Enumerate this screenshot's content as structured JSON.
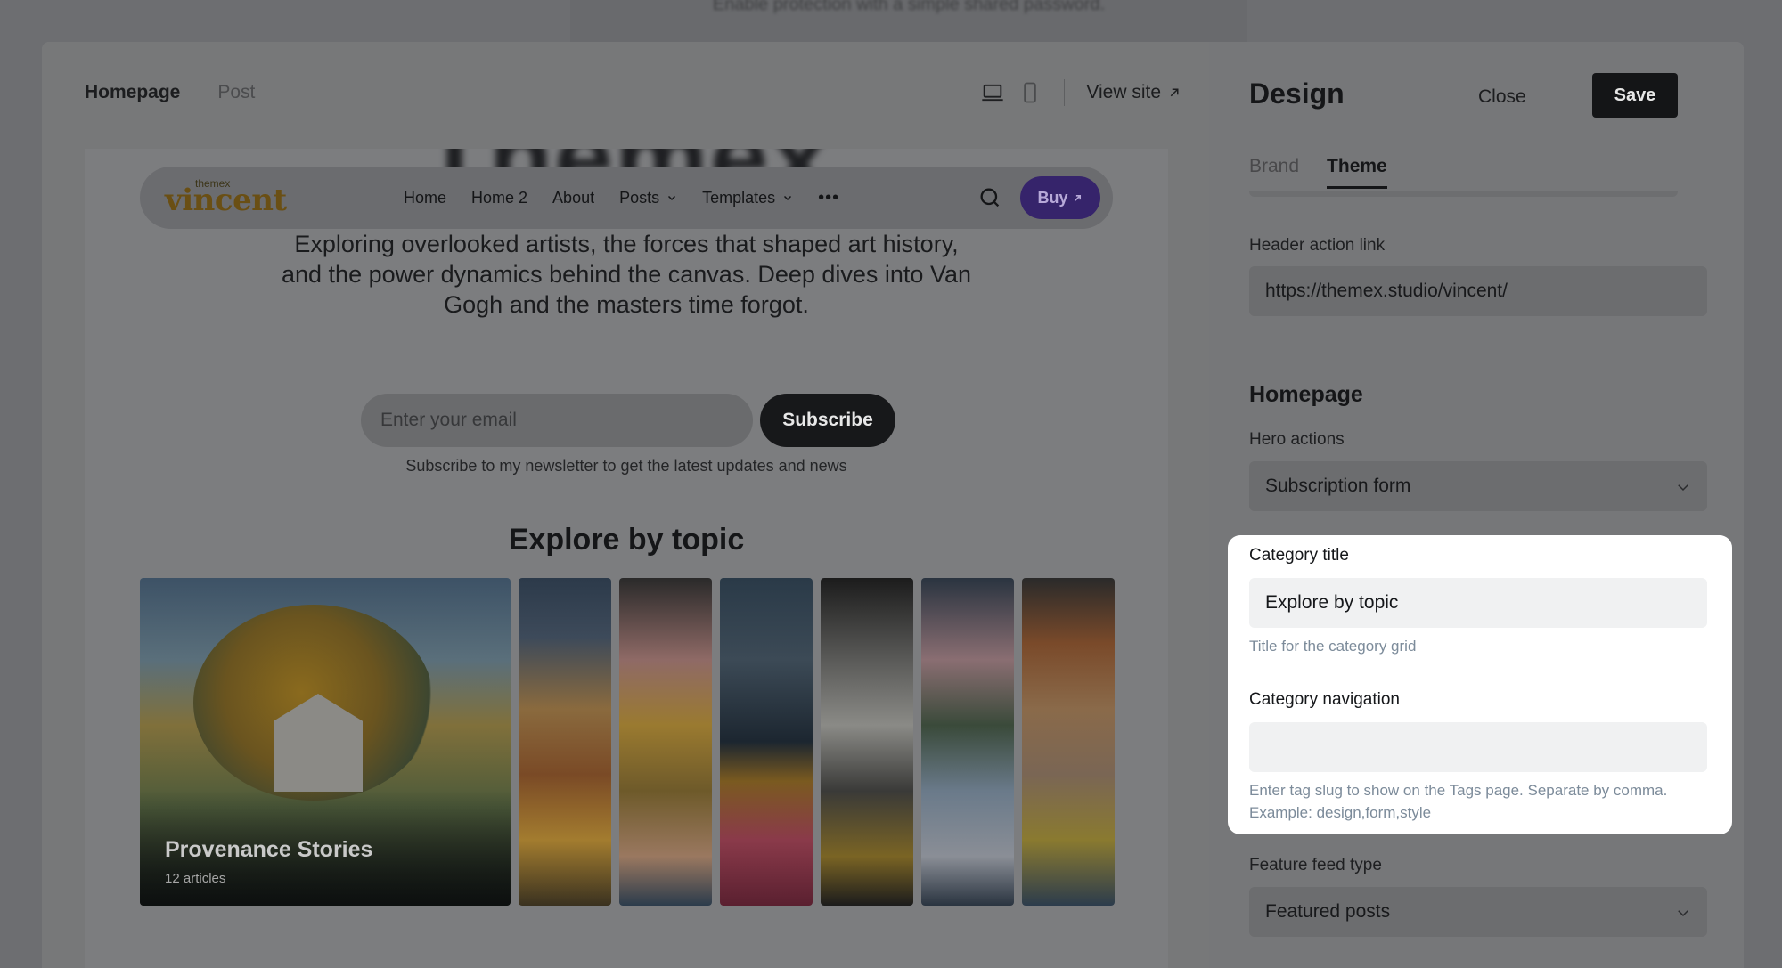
{
  "background": {
    "hint_text": "Enable protection with a simple shared password."
  },
  "preview": {
    "tabs": [
      "Homepage",
      "Post"
    ],
    "view_site_label": "View site",
    "ghost_title": "Themex",
    "site": {
      "logo_small": "themex",
      "logo_big": "vincent",
      "nav": [
        "Home",
        "Home 2",
        "About",
        "Posts",
        "Templates"
      ],
      "more_label": "•••",
      "buy_label": "Buy",
      "hero_description": "Exploring overlooked artists, the forces that shaped art history, and the power dynamics behind the canvas. Deep dives into Van Gogh and the masters time forgot.",
      "email_placeholder": "Enter your email",
      "subscribe_label": "Subscribe",
      "subscribe_note": "Subscribe to my newsletter to get the latest updates and news",
      "explore_title": "Explore by topic",
      "featured_card": {
        "title": "Provenance Stories",
        "count": "12 articles"
      }
    }
  },
  "panel": {
    "title": "Design",
    "close_label": "Close",
    "save_label": "Save",
    "tabs": [
      "Brand",
      "Theme"
    ],
    "active_tab": "Theme",
    "header_action_link": {
      "label": "Header action link",
      "value": "https://themex.studio/vincent/"
    },
    "homepage_section": "Homepage",
    "hero_actions": {
      "label": "Hero actions",
      "value": "Subscription form"
    },
    "category_title": {
      "label": "Category title",
      "value": "Explore by topic",
      "hint": "Title for the category grid"
    },
    "category_navigation": {
      "label": "Category navigation",
      "value": "",
      "hint": "Enter tag slug to show on the Tags page. Separate by comma. Example: design,form,style"
    },
    "feature_feed_type": {
      "label": "Feature feed type",
      "value": "Featured posts"
    }
  },
  "colors": {
    "buy_button": "#5b3fb0",
    "save_button": "#15171a",
    "highlight_bg": "#ffffff",
    "hint_text": "#7c8b9a"
  }
}
